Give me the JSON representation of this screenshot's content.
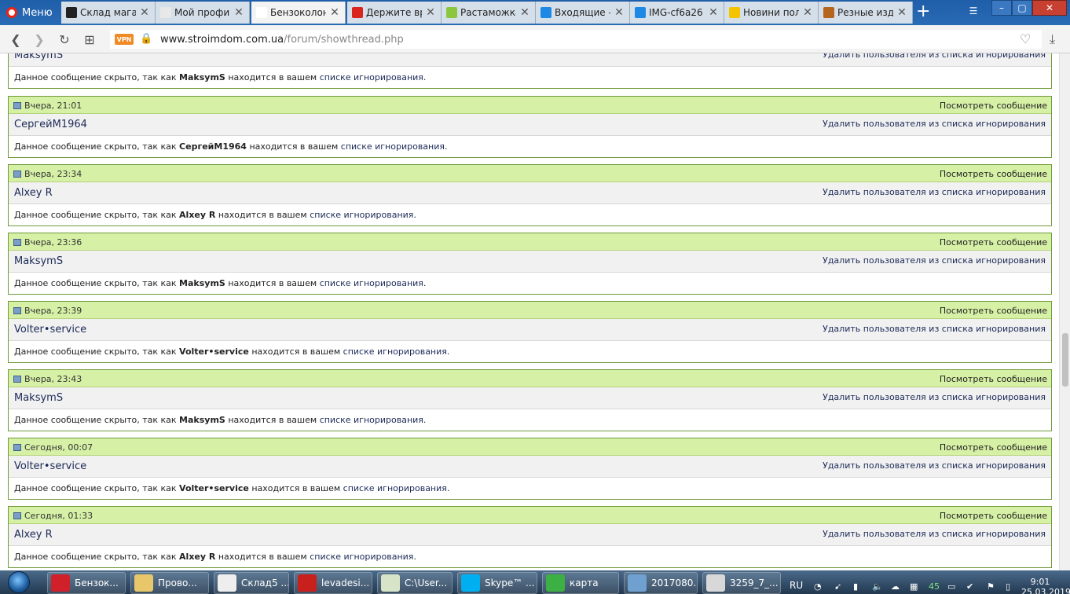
{
  "browser": {
    "menu_label": "Меню",
    "tabs": [
      {
        "title": "Склад магаз",
        "icon": "id-icon",
        "color": "#222222",
        "active": false
      },
      {
        "title": "Мой профи",
        "icon": "olx-icon",
        "color": "#e8e8e8",
        "active": false
      },
      {
        "title": "Бензоколон",
        "icon": "house-icon",
        "color": "#ffffff",
        "active": true
      },
      {
        "title": "Держите вр",
        "icon": "zn-icon",
        "color": "#d9251d",
        "active": false
      },
      {
        "title": "Растаможка",
        "icon": "t-icon",
        "color": "#8cc63f",
        "active": false
      },
      {
        "title": "Входящие -",
        "icon": "mail-at-icon",
        "color": "#1e88e5",
        "active": false
      },
      {
        "title": "IMG-cf6a26",
        "icon": "mail-at-icon",
        "color": "#1e88e5",
        "active": false
      },
      {
        "title": "Новини пол",
        "icon": "coin-icon",
        "color": "#f5c400",
        "active": false
      },
      {
        "title": "Резные изд",
        "icon": "wood-icon",
        "color": "#b5651d",
        "active": false
      }
    ],
    "url_host": "www.stroimdom.com.ua",
    "url_path": "/forum/showthread.php",
    "vpn_label": "VPN"
  },
  "first_post_partial": {
    "username": "MaksymS",
    "remove_label": "Удалить пользователя из списка игнорирования",
    "msg_prefix": "Данное сообщение скрыто, так как",
    "msg_user": "MaksymS",
    "msg_mid": "находится в вашем",
    "msg_link": "списке игнорирования",
    "msg_end": "."
  },
  "posts": [
    {
      "date": "Вчера, 21:01",
      "view": "Посмотреть сообщение",
      "username": "СергейМ1964",
      "remove": "Удалить пользователя из списка игнорирования",
      "prefix": "Данное сообщение скрыто, так как",
      "user_bold": "СергейМ1964",
      "mid": "находится в вашем",
      "link": "списке игнорирования",
      "end": "."
    },
    {
      "date": "Вчера, 23:34",
      "view": "Посмотреть сообщение",
      "username": "Alxey R",
      "remove": "Удалить пользователя из списка игнорирования",
      "prefix": "Данное сообщение скрыто, так как",
      "user_bold": "Alxey R",
      "mid": "находится в вашем",
      "link": "списке игнорирования",
      "end": "."
    },
    {
      "date": "Вчера, 23:36",
      "view": "Посмотреть сообщение",
      "username": "MaksymS",
      "remove": "Удалить пользователя из списка игнорирования",
      "prefix": "Данное сообщение скрыто, так как",
      "user_bold": "MaksymS",
      "mid": "находится в вашем",
      "link": "списке игнорирования",
      "end": "."
    },
    {
      "date": "Вчера, 23:39",
      "view": "Посмотреть сообщение",
      "username": "Volter•service",
      "remove": "Удалить пользователя из списка игнорирования",
      "prefix": "Данное сообщение скрыто, так как",
      "user_bold": "Volter•service",
      "mid": "находится в вашем",
      "link": "списке игнорирования",
      "end": "."
    },
    {
      "date": "Вчера, 23:43",
      "view": "Посмотреть сообщение",
      "username": "MaksymS",
      "remove": "Удалить пользователя из списка игнорирования",
      "prefix": "Данное сообщение скрыто, так как",
      "user_bold": "MaksymS",
      "mid": "находится в вашем",
      "link": "списке игнорирования",
      "end": "."
    },
    {
      "date": "Сегодня, 00:07",
      "view": "Посмотреть сообщение",
      "username": "Volter•service",
      "remove": "Удалить пользователя из списка игнорирования",
      "prefix": "Данное сообщение скрыто, так как",
      "user_bold": "Volter•service",
      "mid": "находится в вашем",
      "link": "списке игнорирования",
      "end": "."
    },
    {
      "date": "Сегодня, 01:33",
      "view": "Посмотреть сообщение",
      "username": "Alxey R",
      "remove": "Удалить пользователя из списка игнорирования",
      "prefix": "Данное сообщение скрыто, так как",
      "user_bold": "Alxey R",
      "mid": "находится в вашем",
      "link": "списке игнорирования",
      "end": "."
    }
  ],
  "taskbar": {
    "items": [
      {
        "label": "Бензок...",
        "icon": "opera-icon",
        "color": "#d0202a"
      },
      {
        "label": "Прово...",
        "icon": "folder-icon",
        "color": "#e8c66a"
      },
      {
        "label": "Склад5 ...",
        "icon": "document-icon",
        "color": "#eeeeee"
      },
      {
        "label": "levadesi...",
        "icon": "filezilla-icon",
        "color": "#c8201c"
      },
      {
        "label": "C:\\User...",
        "icon": "notepad-icon",
        "color": "#d8e4c8"
      },
      {
        "label": "Skype™ ...",
        "icon": "skype-icon",
        "color": "#00aff0"
      },
      {
        "label": "карта",
        "icon": "map-icon",
        "color": "#3cb043"
      },
      {
        "label": "2017080...",
        "icon": "image-icon",
        "color": "#6fa0d0"
      },
      {
        "label": "3259_7_...",
        "icon": "paint-icon",
        "color": "#d8d8d8"
      }
    ],
    "lang": "RU",
    "tray_number": "45",
    "time": "9:01",
    "date": "25.03.2019"
  }
}
